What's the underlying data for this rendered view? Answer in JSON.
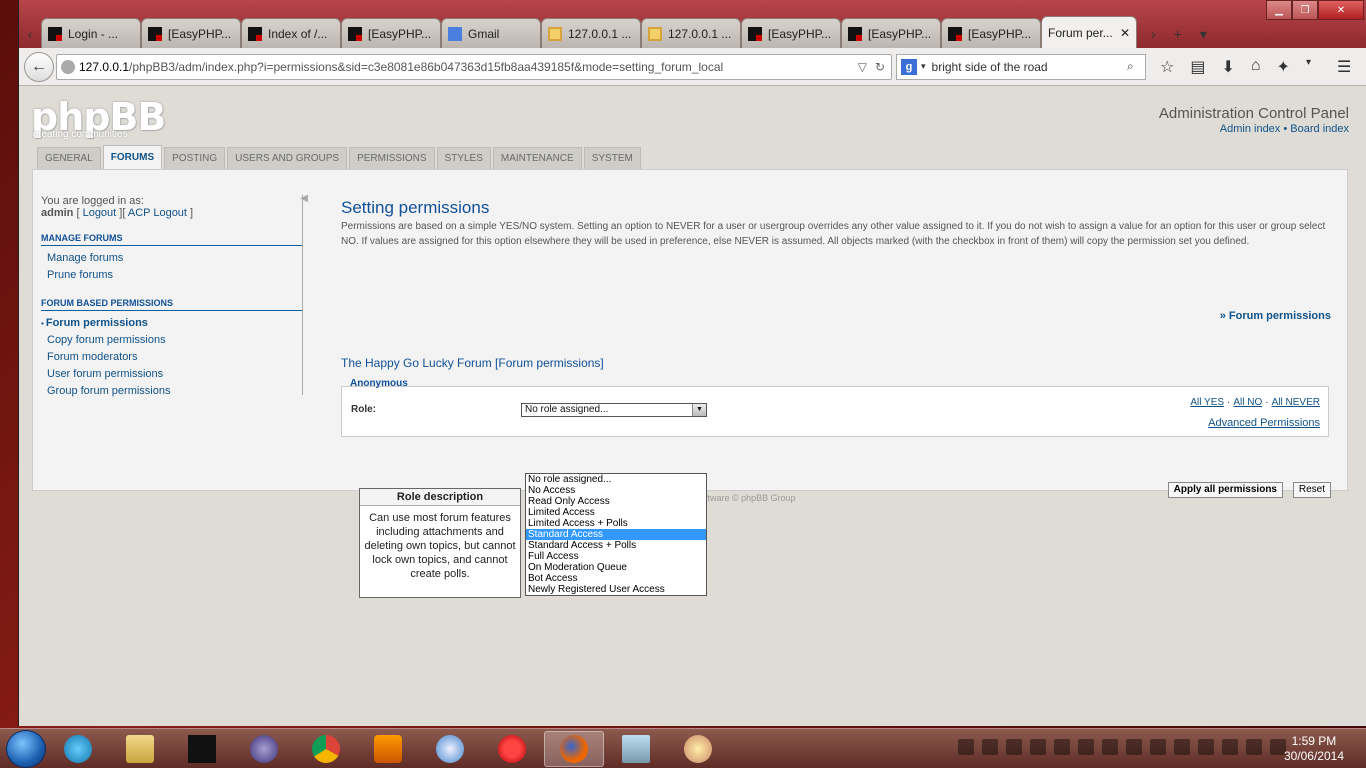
{
  "browser": {
    "tabs": [
      {
        "label": "Login - ...",
        "icon": "github-icon"
      },
      {
        "label": "[EasyPHP...",
        "icon": "easyphp-icon"
      },
      {
        "label": "Index of /...",
        "icon": "easyphp-icon"
      },
      {
        "label": "[EasyPHP...",
        "icon": "easyphp-icon"
      },
      {
        "label": "Gmail",
        "icon": "google-icon"
      },
      {
        "label": "127.0.0.1 ...",
        "icon": "phpmyadmin-icon"
      },
      {
        "label": "127.0.0.1 ...",
        "icon": "phpmyadmin-icon"
      },
      {
        "label": "[EasyPHP...",
        "icon": "easyphp-icon"
      },
      {
        "label": "[EasyPHP...",
        "icon": "easyphp-icon"
      },
      {
        "label": "[EasyPHP...",
        "icon": "easyphp-icon"
      },
      {
        "label": "Forum per...",
        "icon": "none",
        "active": true
      }
    ],
    "url_host": "127.0.0.1",
    "url_rest": "/phpBB3/adm/index.php?i=permissions&sid=c3e8081e86b047363d15fb8aa439185f&mode=setting_forum_local",
    "search_engine": "g",
    "search_query": "bright side of the road"
  },
  "header": {
    "logo": "phpBB",
    "logo_sub": "creating communities",
    "acp_title": "Administration Control Panel",
    "admin_index": "Admin index",
    "sep": " • ",
    "board_index": "Board index"
  },
  "acp_tabs": [
    "GENERAL",
    "FORUMS",
    "POSTING",
    "USERS AND GROUPS",
    "PERMISSIONS",
    "STYLES",
    "MAINTENANCE",
    "SYSTEM"
  ],
  "sidebar": {
    "logged_in_as": "You are logged in as:",
    "user": "admin",
    "logout": "Logout",
    "acp_logout": "ACP Logout",
    "sections": [
      {
        "title": "MANAGE FORUMS",
        "items": [
          "Manage forums",
          "Prune forums"
        ]
      },
      {
        "title": "FORUM BASED PERMISSIONS",
        "items": [
          "Forum permissions",
          "Copy forum permissions",
          "Forum moderators",
          "User forum permissions",
          "Group forum permissions"
        ]
      }
    ]
  },
  "main": {
    "title": "Setting permissions",
    "intro": "Permissions are based on a simple YES/NO system. Setting an option to NEVER for a user or usergroup overrides any other value assigned to it. If you do not wish to assign a value for an option for this user or group select NO. If values are assigned for this option elsewhere they will be used in preference, else NEVER is assumed. All objects marked (with the checkbox in front of them) will copy the permission set you defined.",
    "forum_perm_link": "» Forum permissions",
    "forum_heading": "The Happy Go Lucky Forum [Forum permissions]",
    "group_label": "Anonymous",
    "role_label": "Role:",
    "role_selected": "No role assigned...",
    "all_yes": "All YES",
    "all_no": "All NO",
    "all_never": "All NEVER",
    "advanced": "Advanced Permissions",
    "role_options": [
      "No role assigned...",
      "No Access",
      "Read Only Access",
      "Limited Access",
      "Limited Access + Polls",
      "Standard Access",
      "Standard Access + Polls",
      "Full Access",
      "On Moderation Queue",
      "Bot Access",
      "Newly Registered User Access"
    ],
    "highlighted_index": 5,
    "role_desc_title": "Role description",
    "role_desc_text": "Can use most forum features including attachments and deleting own topics, but cannot lock own topics, and cannot create polls.",
    "apply_all": "Apply all permissions",
    "reset": "Reset",
    "footer": "ftware © phpBB Group"
  },
  "taskbar": {
    "time": "1:59 PM",
    "date": "30/06/2014"
  }
}
